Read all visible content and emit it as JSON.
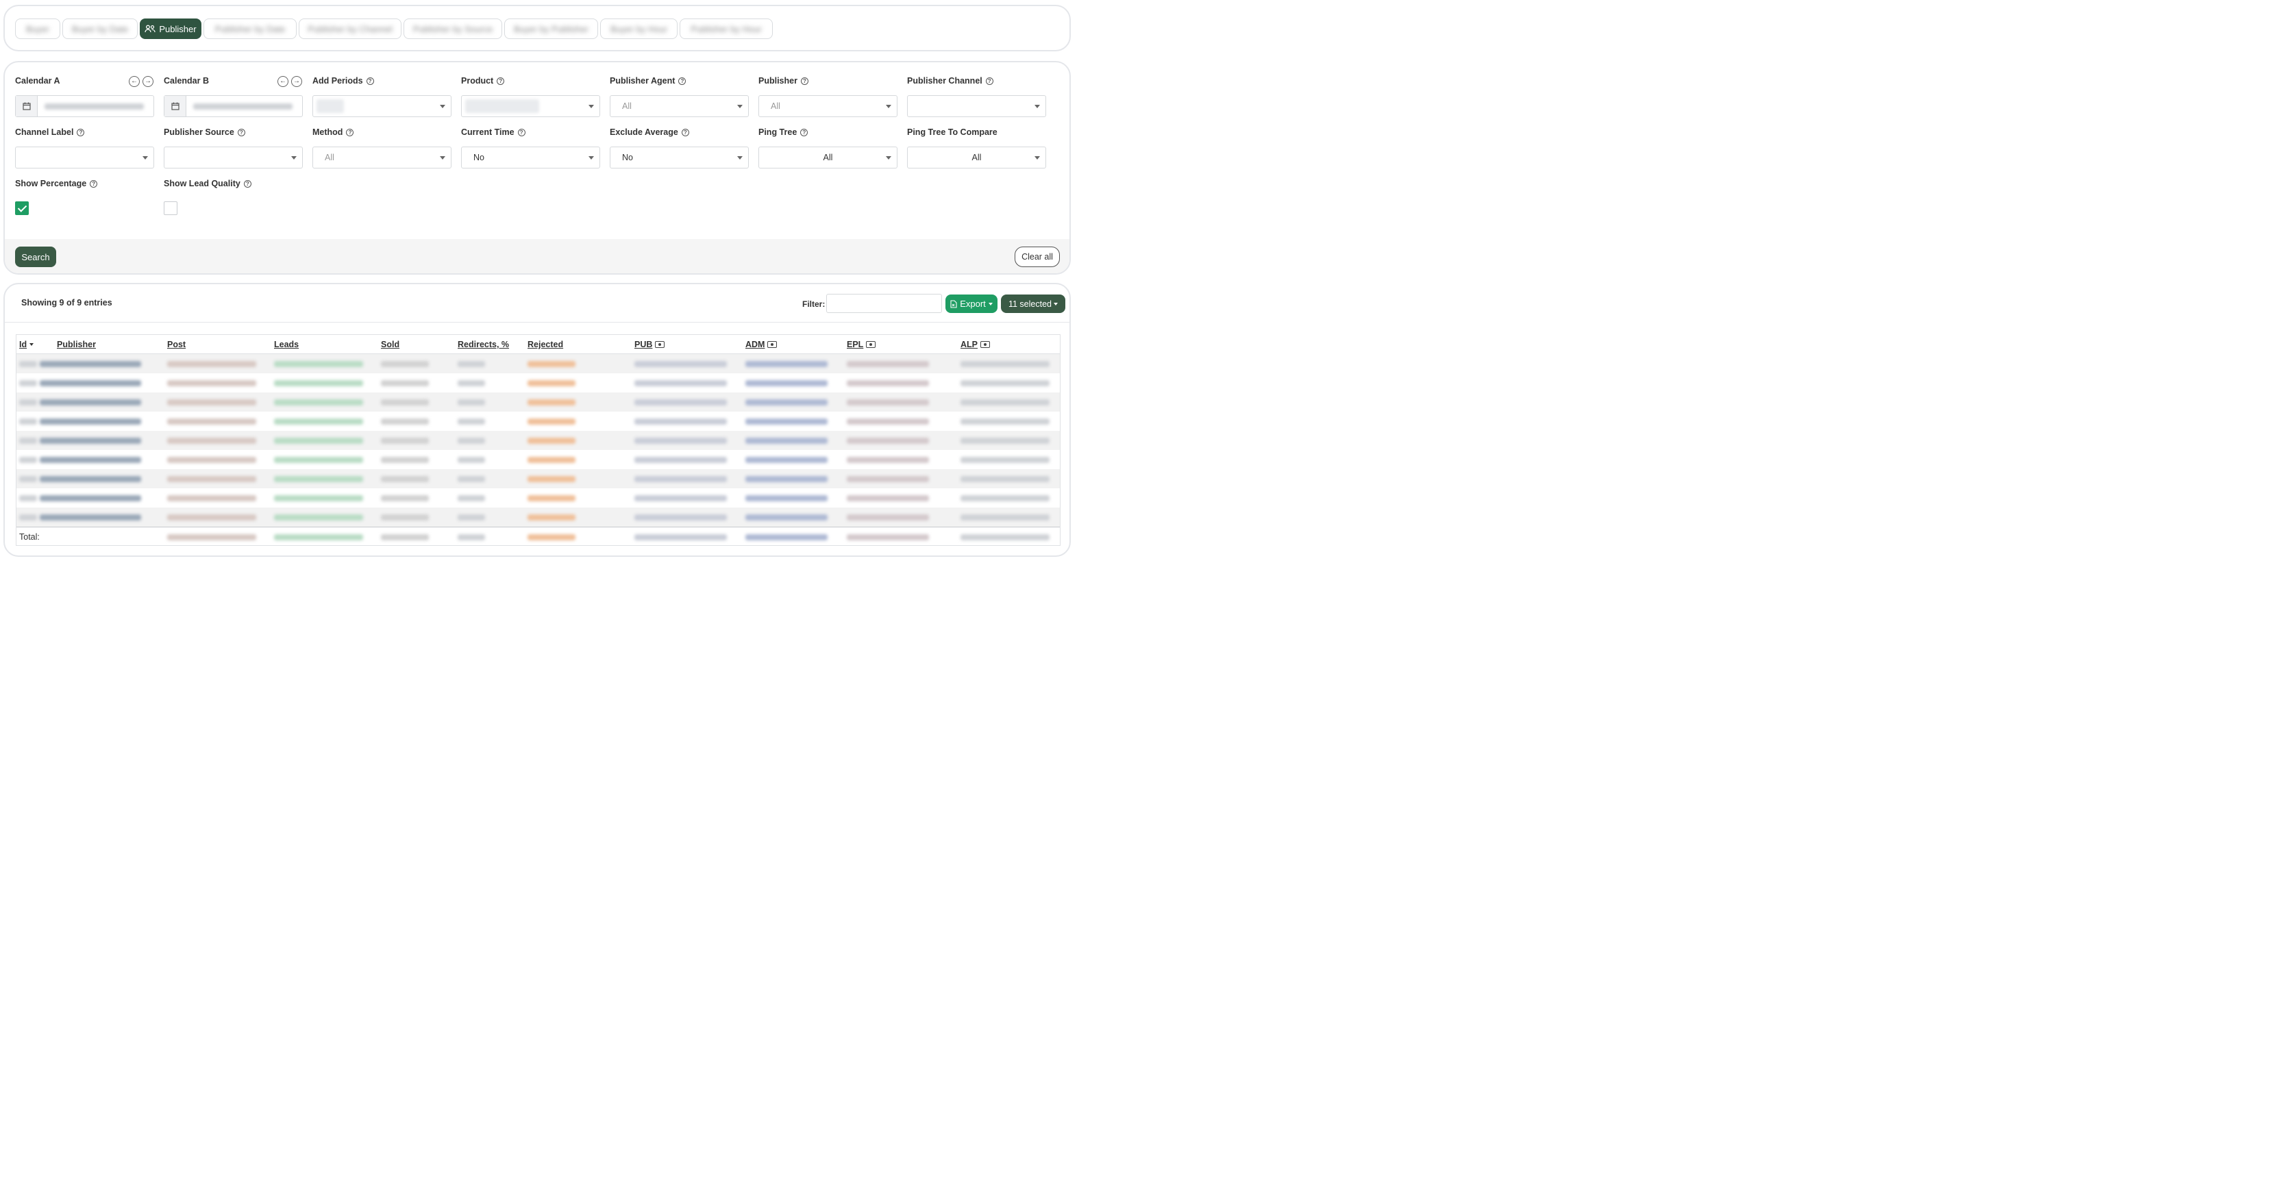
{
  "tabs": [
    {
      "label": "Buyer",
      "active": false
    },
    {
      "label": "Buyer by Date",
      "active": false
    },
    {
      "label": "Publisher",
      "active": true
    },
    {
      "label": "Publisher by Date",
      "active": false
    },
    {
      "label": "Publisher by Channel",
      "active": false
    },
    {
      "label": "Publisher by Source",
      "active": false
    },
    {
      "label": "Buyer by Publisher",
      "active": false
    },
    {
      "label": "Buyer by Hour",
      "active": false
    },
    {
      "label": "Publisher by Hour",
      "active": false
    }
  ],
  "filters": {
    "calendar_a": {
      "label": "Calendar A"
    },
    "calendar_b": {
      "label": "Calendar B"
    },
    "add_periods": {
      "label": "Add Periods"
    },
    "product": {
      "label": "Product"
    },
    "publisher_agent": {
      "label": "Publisher Agent",
      "value": "All"
    },
    "publisher": {
      "label": "Publisher",
      "value": "All"
    },
    "publisher_channel": {
      "label": "Publisher Channel",
      "value": ""
    },
    "channel_label": {
      "label": "Channel Label",
      "value": ""
    },
    "publisher_source": {
      "label": "Publisher Source",
      "value": ""
    },
    "method": {
      "label": "Method",
      "value": "All"
    },
    "current_time": {
      "label": "Current Time",
      "value": "No"
    },
    "exclude_average": {
      "label": "Exclude Average",
      "value": "No"
    },
    "ping_tree": {
      "label": "Ping Tree",
      "value": "All"
    },
    "ping_tree_compare": {
      "label": "Ping Tree To Compare",
      "value": "All"
    },
    "show_percentage": {
      "label": "Show Percentage",
      "checked": true
    },
    "show_lead_quality": {
      "label": "Show Lead Quality",
      "checked": false
    }
  },
  "actions": {
    "search": "Search",
    "clear_all": "Clear all"
  },
  "table": {
    "showing": "Showing 9 of 9 entries",
    "filter_label": "Filter:",
    "export_label": "Export",
    "selected_label": "11 selected",
    "columns": [
      "Id",
      "Publisher",
      "Post",
      "Leads",
      "Sold",
      "Redirects, %",
      "Rejected",
      "PUB",
      "ADM",
      "EPL",
      "ALP"
    ],
    "total_label": "Total:"
  },
  "colors": {
    "accent_dark": "#3a5a45",
    "accent_green": "#1f9d63"
  }
}
